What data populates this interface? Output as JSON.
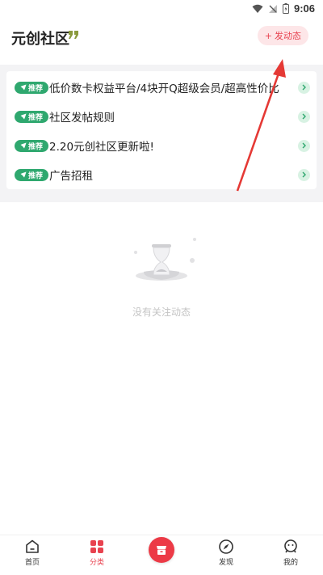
{
  "status_bar": {
    "time": "9:06"
  },
  "header": {
    "title": "元创社区",
    "post_button_label": "发动态"
  },
  "announcements": [
    {
      "tag": "推荐",
      "text": "低价数卡权益平台/4块开Q超级会员/超高性价比"
    },
    {
      "tag": "推荐",
      "text": "社区发帖规则"
    },
    {
      "tag": "推荐",
      "text": "2.20元创社区更新啦!"
    },
    {
      "tag": "推荐",
      "text": "广告招租"
    }
  ],
  "empty_state": {
    "text": "没有关注动态"
  },
  "bottom_nav": [
    {
      "label": "首页",
      "icon": "home-icon"
    },
    {
      "label": "分类",
      "icon": "grid-icon",
      "active": true
    },
    {
      "label": "",
      "icon": "shop-icon"
    },
    {
      "label": "发现",
      "icon": "compass-icon"
    },
    {
      "label": "我的",
      "icon": "profile-icon"
    }
  ],
  "colors": {
    "accent": "#e8424f",
    "tag": "#2fa86f",
    "arrow": "#e53935"
  }
}
